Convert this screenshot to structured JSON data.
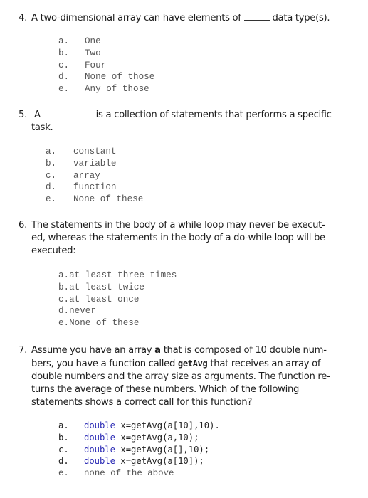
{
  "questions": [
    {
      "number": "4.",
      "text_before": "A two-dimensional array can have elements of",
      "text_after": "data type(s).",
      "options": [
        {
          "label": "a.",
          "text": "One"
        },
        {
          "label": "b.",
          "text": "Two"
        },
        {
          "label": "c.",
          "text": "Four"
        },
        {
          "label": "d.",
          "text": "None of those"
        },
        {
          "label": "e.",
          "text": "Any of those"
        }
      ]
    },
    {
      "number": "5.",
      "text_before": "A",
      "text_after": "is a collection of statements that performs a specific",
      "text_line2": "task.",
      "options": [
        {
          "label": "a.",
          "text": "constant"
        },
        {
          "label": "b.",
          "text": "variable"
        },
        {
          "label": "c.",
          "text": "array"
        },
        {
          "label": "d.",
          "text": "function"
        },
        {
          "label": "e.",
          "text": "None of these"
        }
      ]
    },
    {
      "number": "6.",
      "lines": [
        "The statements in the body of a while loop may never be execut-",
        "ed, whereas the statements in the body of a do-while loop will be",
        "executed:"
      ],
      "options": [
        {
          "label": "a.",
          "text": "at least three times"
        },
        {
          "label": "b.",
          "text": "at least twice"
        },
        {
          "label": "c.",
          "text": "at least once"
        },
        {
          "label": "d.",
          "text": "never"
        },
        {
          "label": "e.",
          "text": "None of these"
        }
      ]
    },
    {
      "number": "7.",
      "line1_a": "Assume you have an array",
      "line1_var": "a",
      "line1_b": "that is composed of 10 double num-",
      "line2_a": "bers, you have a function called",
      "line2_fn": "getAvg",
      "line2_b": "that receives an array of",
      "lines_rest": [
        "double numbers and the array size as arguments. The function re-",
        "turns the average of these numbers.  Which of the following",
        "statements shows a correct call for this function?"
      ],
      "options": [
        {
          "label": "a.",
          "kw": "double",
          "text": " x=getAvg(a[10],10)."
        },
        {
          "label": "b.",
          "kw": "double",
          "text": " x=getAvg(a,10);"
        },
        {
          "label": "c.",
          "kw": "double",
          "text": " x=getAvg(a[],10);"
        },
        {
          "label": "d.",
          "kw": "double",
          "text": " x=getAvg(a[10]);"
        },
        {
          "label": "e.",
          "kw": "",
          "text": "none of the above"
        }
      ]
    }
  ]
}
